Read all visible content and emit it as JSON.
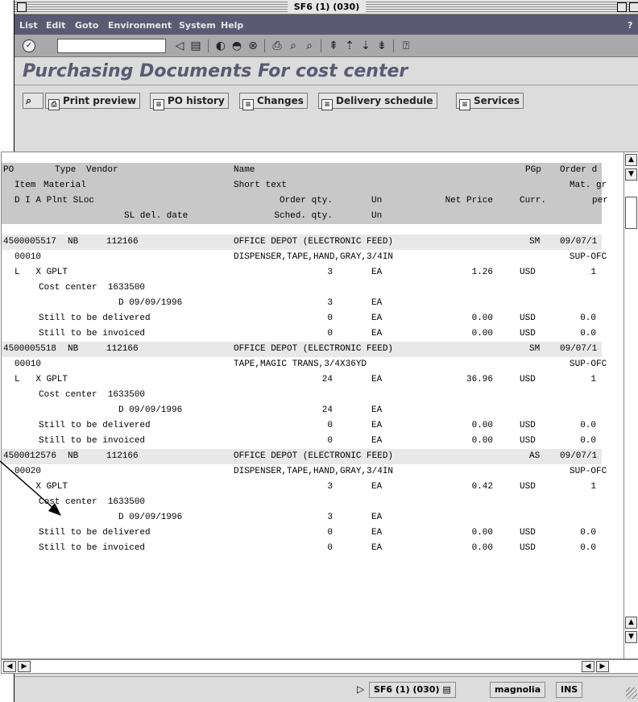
{
  "window": {
    "title": "SF6 (1) (030)"
  },
  "menu": [
    "List",
    "Edit",
    "Goto",
    "Environment",
    "System",
    "Help"
  ],
  "menu_help_marker": "?",
  "toolbar": {
    "command_field_value": "",
    "icons": [
      "enter-icon",
      "back-icon",
      "save-icon",
      "back-nav-icon",
      "exit-icon",
      "cancel-icon",
      "print-icon",
      "find-icon",
      "find-next-icon",
      "first-page-icon",
      "prev-page-icon",
      "next-page-icon",
      "last-page-icon",
      "help-icon"
    ]
  },
  "page_title": "Purchasing Documents For cost center",
  "app_buttons": [
    {
      "label": ""
    },
    {
      "label": "Print preview"
    },
    {
      "label": "PO history"
    },
    {
      "label": "Changes"
    },
    {
      "label": "Delivery schedule"
    },
    {
      "label": "Services"
    }
  ],
  "list": {
    "header_lines": [
      [
        "PO",
        "Type",
        "Vendor",
        "Name",
        "",
        "",
        "PGp",
        "Order d"
      ],
      [
        "Item",
        "Material",
        "",
        "Short text",
        "",
        "",
        "",
        "Mat. gr"
      ],
      [
        "D I A Plnt SLoc",
        "",
        "",
        "Order qty.",
        "Un",
        "Net Price",
        "Curr.",
        "per"
      ],
      [
        "SL del. date",
        "",
        "",
        "Sched. qty.",
        "Un",
        "",
        "",
        ""
      ]
    ],
    "documents": [
      {
        "po": "4500005517",
        "type": "NB",
        "vendor": "112166",
        "name": "OFFICE DEPOT (ELECTRONIC FEED)",
        "pgp": "SM",
        "order_date": "09/07/1",
        "item": "00010",
        "short_text": "DISPENSER,TAPE,HAND,GRAY,3/4IN",
        "mat_group": "SUP-OFC",
        "dia": "L   X GPLT",
        "order_qty": "3",
        "unit": "EA",
        "net_price": "1.26",
        "curr": "USD",
        "per": "1",
        "cost_center": "Cost center  1633500",
        "sched_line": "D 09/09/1996",
        "sched_qty": "3",
        "sched_unit": "EA",
        "deliv_label": "Still to be delivered",
        "deliv_qty": "0",
        "deliv_unit": "EA",
        "deliv_amt": "0.00",
        "deliv_curr": "USD",
        "deliv_per": "0.0",
        "inv_label": "Still to be invoiced",
        "inv_qty": "0",
        "inv_unit": "EA",
        "inv_amt": "0.00",
        "inv_curr": "USD",
        "inv_per": "0.0"
      },
      {
        "po": "4500005518",
        "type": "NB",
        "vendor": "112166",
        "name": "OFFICE DEPOT (ELECTRONIC FEED)",
        "pgp": "SM",
        "order_date": "09/07/1",
        "item": "00010",
        "short_text": "TAPE,MAGIC TRANS,3/4X36YD",
        "mat_group": "SUP-OFC",
        "dia": "L   X GPLT",
        "order_qty": "24",
        "unit": "EA",
        "net_price": "36.96",
        "curr": "USD",
        "per": "1",
        "cost_center": "Cost center  1633500",
        "sched_line": "D 09/09/1996",
        "sched_qty": "24",
        "sched_unit": "EA",
        "deliv_label": "Still to be delivered",
        "deliv_qty": "0",
        "deliv_unit": "EA",
        "deliv_amt": "0.00",
        "deliv_curr": "USD",
        "deliv_per": "0.0",
        "inv_label": "Still to be invoiced",
        "inv_qty": "0",
        "inv_unit": "EA",
        "inv_amt": "0.00",
        "inv_curr": "USD",
        "inv_per": "0.0"
      },
      {
        "po": "4500012576",
        "type": "NB",
        "vendor": "112166",
        "name": "OFFICE DEPOT (ELECTRONIC FEED)",
        "pgp": "AS",
        "order_date": "09/07/1",
        "item": "00020",
        "short_text": "DISPENSER,TAPE,HAND,GRAY,3/4IN",
        "mat_group": "SUP-OFC",
        "dia": "    X GPLT",
        "order_qty": "3",
        "unit": "EA",
        "net_price": "0.42",
        "curr": "USD",
        "per": "1",
        "cost_center": "Cost center  1633500",
        "sched_line": "D 09/09/1996",
        "sched_qty": "3",
        "sched_unit": "EA",
        "deliv_label": "Still to be delivered",
        "deliv_qty": "0",
        "deliv_unit": "EA",
        "deliv_amt": "0.00",
        "deliv_curr": "USD",
        "deliv_per": "0.0",
        "inv_label": "Still to be invoiced",
        "inv_qty": "0",
        "inv_unit": "EA",
        "inv_amt": "0.00",
        "inv_curr": "USD",
        "inv_per": "0.0"
      }
    ]
  },
  "status": {
    "session": "SF6 (1) (030)",
    "server": "magnolia",
    "mode": "INS"
  },
  "colors": {
    "menubar": "#5a5a73",
    "title_text": "#5a5a73",
    "header_row": "#c8c8c8"
  }
}
